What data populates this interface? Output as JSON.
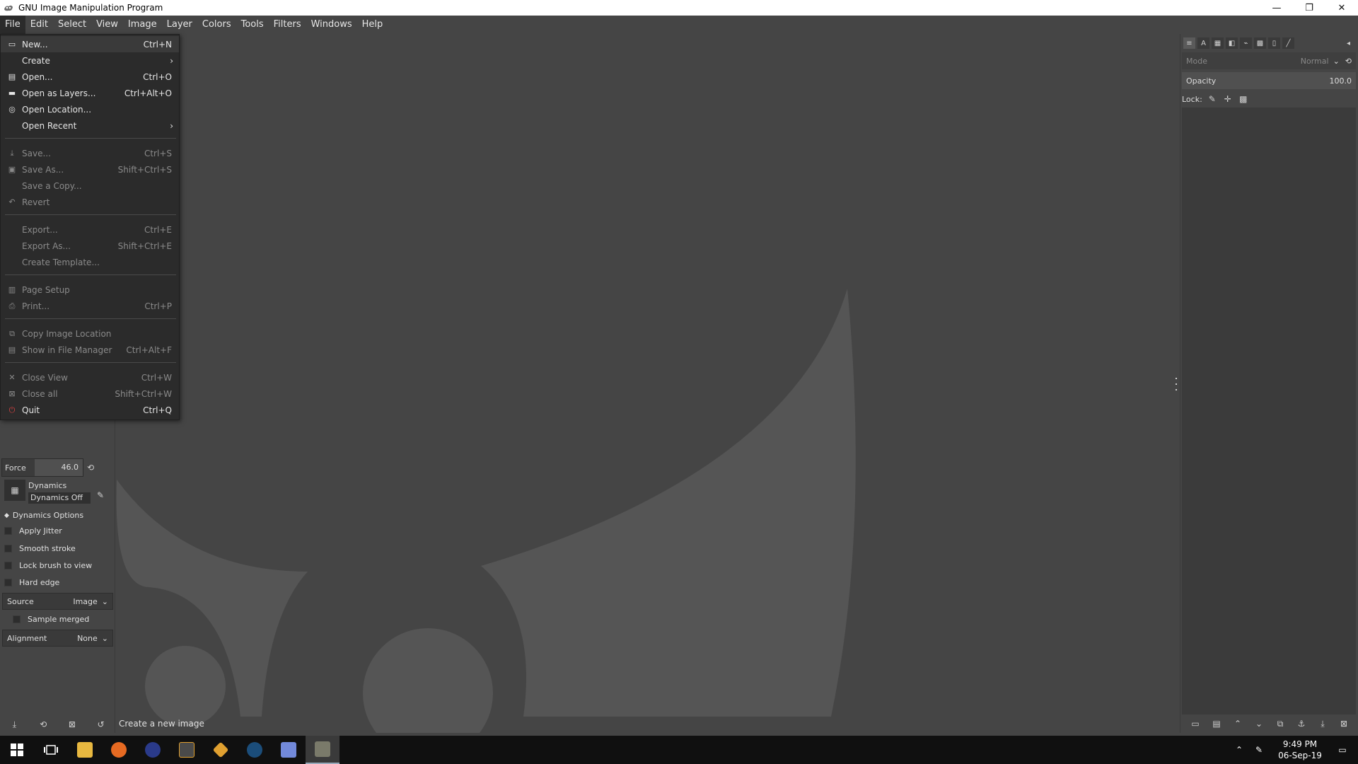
{
  "window": {
    "title": "GNU Image Manipulation Program",
    "minimize": "—",
    "maximize": "❐",
    "close": "✕"
  },
  "menubar": [
    "File",
    "Edit",
    "Select",
    "View",
    "Image",
    "Layer",
    "Colors",
    "Tools",
    "Filters",
    "Windows",
    "Help"
  ],
  "file_menu": [
    {
      "label": "New...",
      "shortcut": "Ctrl+N",
      "enabled": true,
      "icon": "new-image-icon"
    },
    {
      "label": "Create",
      "shortcut": "",
      "enabled": true,
      "submenu": true
    },
    {
      "label": "Open...",
      "shortcut": "Ctrl+O",
      "enabled": true,
      "icon": "open-icon"
    },
    {
      "label": "Open as Layers...",
      "shortcut": "Ctrl+Alt+O",
      "enabled": true,
      "icon": "open-layers-icon"
    },
    {
      "label": "Open Location...",
      "shortcut": "",
      "enabled": true,
      "icon": "globe-icon"
    },
    {
      "label": "Open Recent",
      "shortcut": "",
      "enabled": true,
      "submenu": true
    },
    {
      "label": "Save...",
      "shortcut": "Ctrl+S",
      "enabled": false,
      "icon": "save-icon"
    },
    {
      "label": "Save As...",
      "shortcut": "Shift+Ctrl+S",
      "enabled": false,
      "icon": "save-as-icon"
    },
    {
      "label": "Save a Copy...",
      "shortcut": "",
      "enabled": false
    },
    {
      "label": "Revert",
      "shortcut": "",
      "enabled": false,
      "icon": "revert-icon"
    },
    {
      "label": "Export...",
      "shortcut": "Ctrl+E",
      "enabled": false
    },
    {
      "label": "Export As...",
      "shortcut": "Shift+Ctrl+E",
      "enabled": false
    },
    {
      "label": "Create Template...",
      "shortcut": "",
      "enabled": false
    },
    {
      "label": "Page Setup",
      "shortcut": "",
      "enabled": false,
      "icon": "page-setup-icon"
    },
    {
      "label": "Print...",
      "shortcut": "Ctrl+P",
      "enabled": false,
      "icon": "print-icon"
    },
    {
      "label": "Copy Image Location",
      "shortcut": "",
      "enabled": false,
      "icon": "copy-icon"
    },
    {
      "label": "Show in File Manager",
      "shortcut": "Ctrl+Alt+F",
      "enabled": false,
      "icon": "file-manager-icon"
    },
    {
      "label": "Close View",
      "shortcut": "Ctrl+W",
      "enabled": false,
      "icon": "close-icon"
    },
    {
      "label": "Close all",
      "shortcut": "Shift+Ctrl+W",
      "enabled": false,
      "icon": "close-all-icon"
    },
    {
      "label": "Quit",
      "shortcut": "Ctrl+Q",
      "enabled": true,
      "icon": "quit-icon"
    }
  ],
  "tool_options": {
    "force_label": "Force",
    "force_value": "46.0",
    "dynamics_label": "Dynamics",
    "dynamics_value": "Dynamics Off",
    "dynamics_options": "Dynamics Options",
    "apply_jitter": "Apply Jitter",
    "smooth_stroke": "Smooth stroke",
    "lock_brush": "Lock brush to view",
    "hard_edge": "Hard edge",
    "source_label": "Source",
    "source_value": "Image",
    "sample_merged": "Sample merged",
    "alignment_label": "Alignment",
    "alignment_value": "None"
  },
  "layers_dock": {
    "mode_label": "Mode",
    "mode_value": "Normal",
    "opacity_label": "Opacity",
    "opacity_value": "100.0",
    "lock_label": "Lock:"
  },
  "status": "Create a new image",
  "taskbar": {
    "time": "9:49 PM",
    "date": "06-Sep-19"
  },
  "colors": {
    "background": "#454545",
    "menu_bg": "#2b2b2b",
    "wilber": "#555555"
  }
}
